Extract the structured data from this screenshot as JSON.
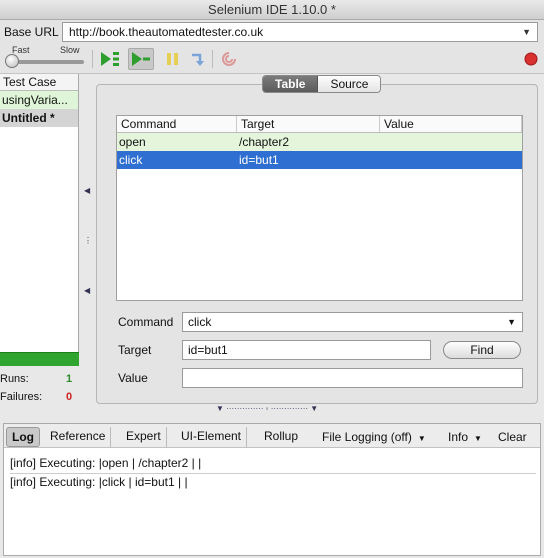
{
  "window": {
    "title": "Selenium IDE 1.10.0 *"
  },
  "base_url": {
    "label": "Base URL",
    "value": "http://book.theautomatedtester.co.uk"
  },
  "toolbar": {
    "speed_fast": "Fast",
    "speed_slow": "Slow",
    "buttons": [
      "play-suite-icon",
      "play-test-icon",
      "pause-icon",
      "step-icon",
      "rollup-icon",
      "record-icon"
    ],
    "colors": {
      "play": "#2e9e2e",
      "pause": "#e6cf55",
      "step": "#7aa3d8",
      "record": "#d93030"
    }
  },
  "test_cases": {
    "header": "Test Case",
    "items": [
      {
        "label": "usingVaria...",
        "state": "passed"
      },
      {
        "label": "Untitled *",
        "state": "selected"
      }
    ]
  },
  "stats": {
    "runs_label": "Runs:",
    "runs": "1",
    "failures_label": "Failures:",
    "failures": "0",
    "progress": 1.0
  },
  "view_tabs": {
    "table": "Table",
    "source": "Source",
    "active": "Table"
  },
  "table": {
    "columns": [
      "Command",
      "Target",
      "Value"
    ],
    "rows": [
      {
        "command": "open",
        "target": "/chapter2",
        "value": ""
      },
      {
        "command": "click",
        "target": "id=but1",
        "value": ""
      }
    ]
  },
  "editor": {
    "command_label": "Command",
    "command_value": "click",
    "target_label": "Target",
    "target_value": "id=but1",
    "find_label": "Find",
    "value_label": "Value",
    "value_value": ""
  },
  "bottom": {
    "tabs": [
      "Log",
      "Reference",
      "Expert",
      "UI-Element",
      "Rollup"
    ],
    "active_tab": "Log",
    "file_logging": "File Logging (off)",
    "level": "Info",
    "clear": "Clear",
    "log": [
      "[info] Executing: |open | /chapter2 | |",
      "[info] Executing: |click | id=but1 | |"
    ]
  }
}
